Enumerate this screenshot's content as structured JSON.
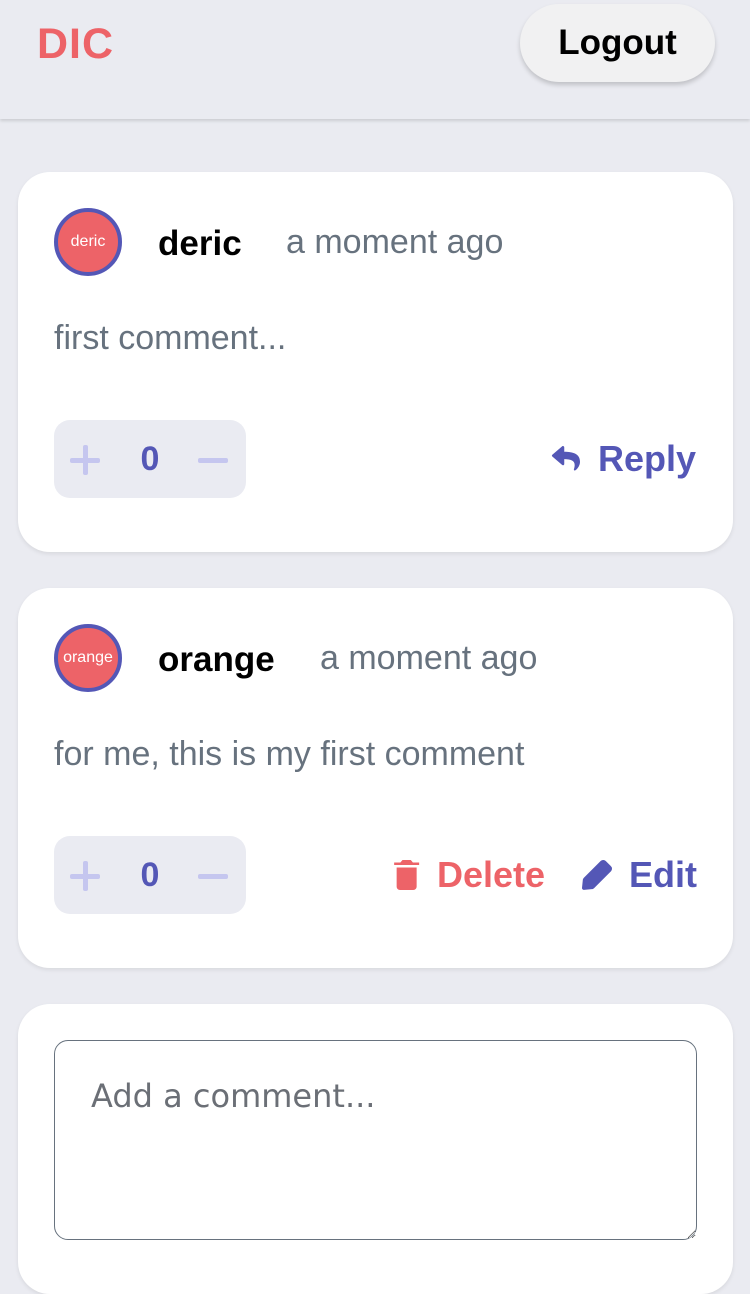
{
  "header": {
    "logo": "DIC",
    "logout_label": "Logout"
  },
  "comments": [
    {
      "avatar_text": "deric",
      "username": "deric",
      "time": "a moment ago",
      "content": "first comment...",
      "score": "0",
      "actions": {
        "reply": "Reply"
      }
    },
    {
      "avatar_text": "orange",
      "username": "orange",
      "time": "a moment ago",
      "content": "for me, this is my first comment",
      "score": "0",
      "actions": {
        "delete": "Delete",
        "edit": "Edit"
      }
    }
  ],
  "composer": {
    "placeholder": "Add a comment..."
  },
  "colors": {
    "accent": "#5457b6",
    "danger": "#ed6368",
    "muted_text": "#67727e",
    "background": "#eaebf1"
  },
  "icons": [
    "plus-icon",
    "minus-icon",
    "reply-icon",
    "trash-icon",
    "pencil-icon"
  ]
}
